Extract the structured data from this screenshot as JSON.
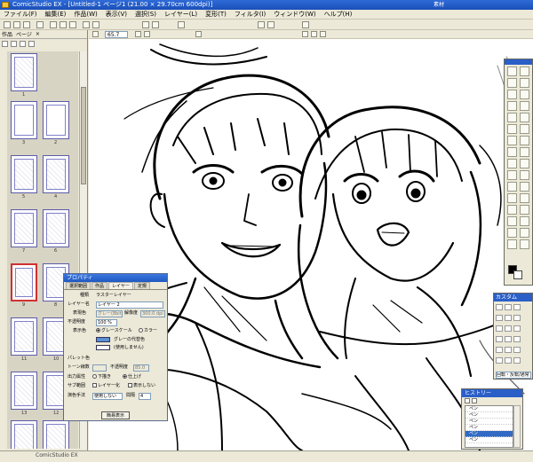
{
  "window": {
    "title": "ComicStudio EX - [Untitled-1 ページ1 (21.00 × 29.70cm 600dpi)]",
    "aux_title": "素材"
  },
  "menu": [
    "ファイル(F)",
    "編集(E)",
    "作品(W)",
    "表示(V)",
    "選択(S)",
    "レイヤー(L)",
    "変形(T)",
    "フィルタ(I)",
    "ウィンドウ(W)",
    "ヘルプ(H)"
  ],
  "toolbar": {
    "zoom": "65.7"
  },
  "page_panel": {
    "tabs": [
      "作品",
      "ページ",
      "×"
    ],
    "pages": [
      "1",
      "2",
      "3",
      "4",
      "5",
      "6",
      "7",
      "8",
      "9",
      "10",
      "11",
      "12",
      "13",
      "14"
    ],
    "selected_page": "8"
  },
  "properties": {
    "title": "プロパティ",
    "tabs": [
      "選択範囲",
      "作品",
      "レイヤー",
      "定規"
    ],
    "kind_label": "種類",
    "kind_value": "ラスターレイヤー",
    "name_label": "レイヤー名",
    "name_value": "レイヤー 2",
    "expression_label": "表現色",
    "expression_value": "グレー(8bit)",
    "resolution_label": "解像度",
    "resolution_value": "300.0 dpi",
    "opacity_label": "不透明度",
    "opacity_value": "100 %",
    "display_color_label": "表示色",
    "grayscale": "グレースケール",
    "color": "カラー",
    "gray_substitute": "グレーの代替色",
    "unused": "(使用しません)",
    "palette_label": "パレット色",
    "tone_label": "トーン線数",
    "opacity2_label": "不透明度",
    "tone_value": "85.0",
    "output_label": "出力属性",
    "below": "下描き",
    "finish": "仕上げ",
    "sub_label": "サブ範囲",
    "layer_check": "レイヤー化",
    "hide_check": "表示しない",
    "mode_label": "演色手法",
    "mode_value": "使用しない",
    "interval_label": "間隔",
    "interval_value": "4",
    "simple_button": "簡易表示"
  },
  "tool_options": {
    "title": "カスタム",
    "mode_label": "回転・反転/通常"
  },
  "history": {
    "title": "ヒストリー",
    "items": [
      "ペン",
      "ペン",
      "ペン",
      "ペン",
      "ペン",
      "ペン"
    ],
    "selected_index": 4
  },
  "statusbar": {
    "brand": "ComicStudio EX"
  },
  "colors": {
    "titlebar": "#1f58c0",
    "chrome": "#ece9d8",
    "selection": "#316ac5"
  }
}
